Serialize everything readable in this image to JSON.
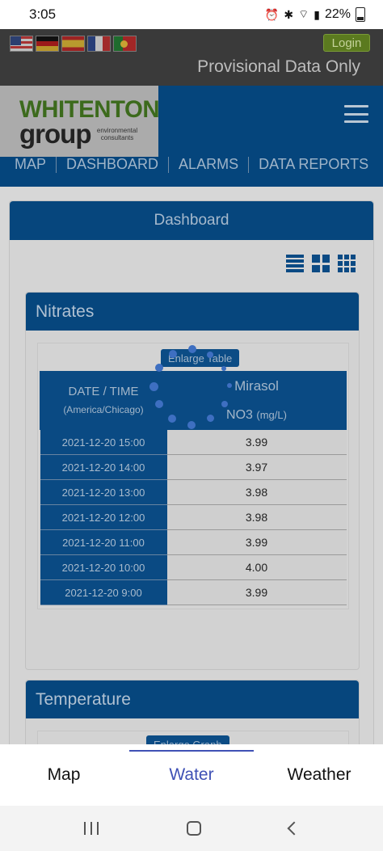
{
  "status_bar": {
    "time": "3:05",
    "battery": "22%",
    "icons": [
      "alarm-icon",
      "bluetooth-icon",
      "wifi-icon",
      "signal-icon",
      "battery-icon"
    ]
  },
  "header": {
    "flags": [
      "us-flag-icon",
      "germany-flag-icon",
      "spain-flag-icon",
      "france-flag-icon",
      "portugal-flag-icon"
    ],
    "login_label": "Login",
    "provisional_text": "Provisional Data Only"
  },
  "brand": {
    "logo_line1": "WHITENTON",
    "logo_line2": "group",
    "logo_sub": "environmental consultants"
  },
  "nav": {
    "items": [
      "MAP",
      "DASHBOARD",
      "ALARMS",
      "DATA REPORTS"
    ]
  },
  "dashboard": {
    "title": "Dashboard",
    "view_icons": [
      "list-view-icon",
      "grid-4-view-icon",
      "grid-9-view-icon"
    ]
  },
  "nitrates": {
    "title": "Nitrates",
    "enlarge_label": "Enlarge Table",
    "col_time": "DATE / TIME",
    "col_tz": "(America/Chicago)",
    "site": "Mirasol",
    "param": "NO3",
    "unit": "(mg/L)",
    "rows": [
      {
        "time": "2021-12-20 15:00",
        "value": "3.99"
      },
      {
        "time": "2021-12-20 14:00",
        "value": "3.97"
      },
      {
        "time": "2021-12-20 13:00",
        "value": "3.98"
      },
      {
        "time": "2021-12-20 12:00",
        "value": "3.98"
      },
      {
        "time": "2021-12-20 11:00",
        "value": "3.99"
      },
      {
        "time": "2021-12-20 10:00",
        "value": "4.00"
      },
      {
        "time": "2021-12-20 9:00",
        "value": "3.99"
      }
    ]
  },
  "temperature": {
    "title": "Temperature",
    "enlarge_label": "Enlarge Graph"
  },
  "tabbar": {
    "tabs": [
      "Map",
      "Water",
      "Weather"
    ],
    "active": "Water"
  },
  "colors": {
    "brand_blue": "#05457c",
    "accent": "#3f51b5",
    "logo_green": "#3c6a1c"
  }
}
